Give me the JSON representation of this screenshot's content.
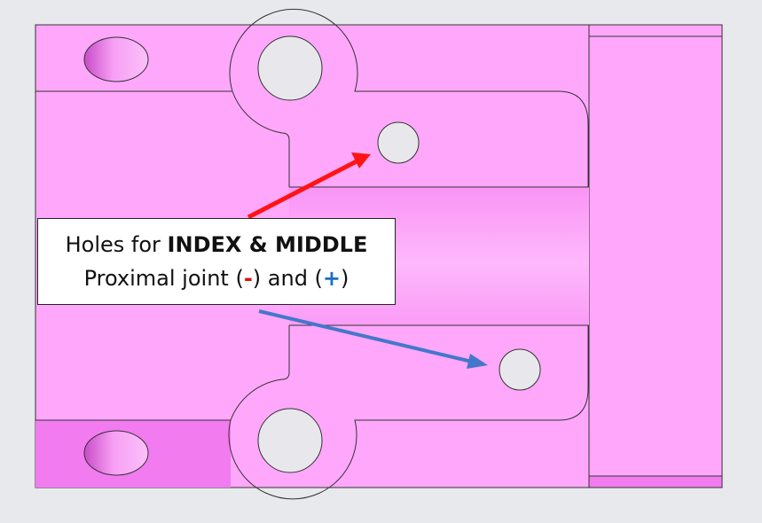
{
  "callout": {
    "line1_prefix": "Holes for ",
    "line1_bold": "INDEX & MIDDLE",
    "line2_prefix": "Proximal joint (",
    "minus": "-",
    "line2_mid": ") and (",
    "plus": "+",
    "line2_suffix": ")"
  },
  "colors": {
    "part_fill": "#fea7fb",
    "part_dark": "#f077ef",
    "hole_fill": "#e8e8ec",
    "arrow_negative": "#ff1414",
    "arrow_positive": "#4477cc",
    "label_negative": "#e01010",
    "label_positive": "#1a6fc4"
  }
}
